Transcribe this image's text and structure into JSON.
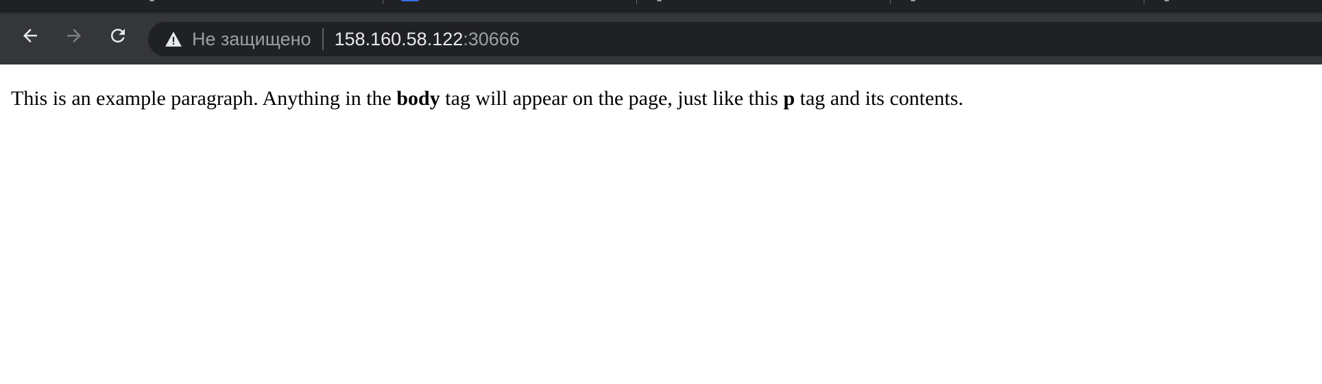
{
  "browser": {
    "security_label": "Не защищено",
    "url_host": "158.160.58.122",
    "url_port": ":30666",
    "colors": {
      "toolbar": "#35363a",
      "omnibox": "#202124",
      "tab_strip": "#202124",
      "active_tab_favicon": "#3b6fe6"
    },
    "icons": {
      "back": "arrow-left-icon",
      "forward": "arrow-right-icon",
      "reload": "reload-icon",
      "security": "warning-triangle-icon"
    }
  },
  "page": {
    "paragraph": {
      "text_1": "This is an example paragraph. Anything in the ",
      "bold_1": "body",
      "text_2": " tag will appear on the page, just like this ",
      "bold_2": "p",
      "text_3": " tag and its contents."
    }
  }
}
